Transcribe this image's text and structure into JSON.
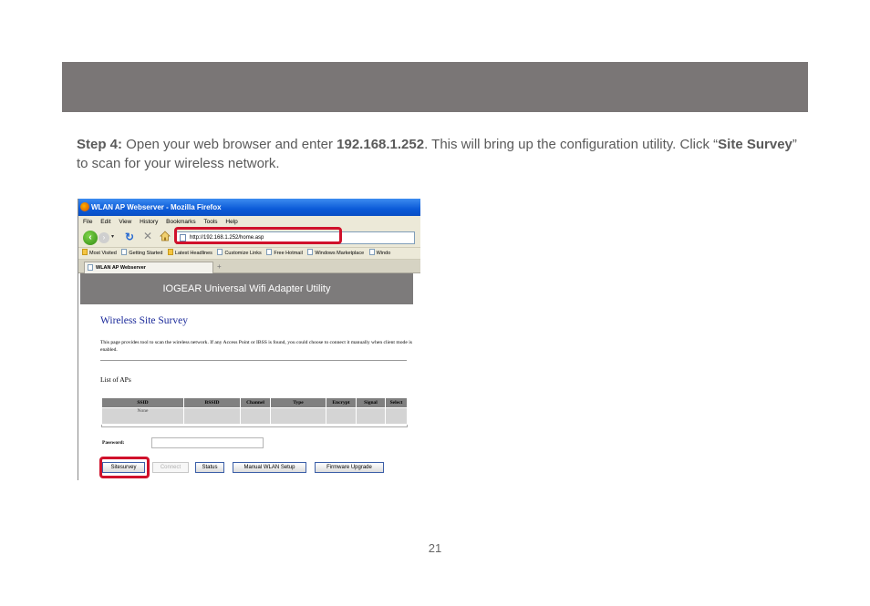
{
  "doc": {
    "step_label": "Step 4:",
    "text_part1": " Open your web browser and enter ",
    "ip": "192.168.1.252",
    "text_part2": ". This will bring up the configuration utility. Click “",
    "site_survey": "Site Survey",
    "text_part3": "” to scan for your wireless network.",
    "page_number": "21"
  },
  "browser": {
    "window_title": "WLAN AP Webserver - Mozilla Firefox",
    "menu": [
      "File",
      "Edit",
      "View",
      "History",
      "Bookmarks",
      "Tools",
      "Help"
    ],
    "url": "http://192.168.1.252/home.asp",
    "bookmarks": [
      {
        "label": "Most Visited",
        "icon": "folder-icon"
      },
      {
        "label": "Getting Started",
        "icon": "page-icon"
      },
      {
        "label": "Latest Headlines",
        "icon": "folder-icon"
      },
      {
        "label": "Customize Links",
        "icon": "page-icon"
      },
      {
        "label": "Free Hotmail",
        "icon": "page-icon"
      },
      {
        "label": "Windows Marketplace",
        "icon": "page-icon"
      },
      {
        "label": "Windo",
        "icon": "page-icon"
      }
    ],
    "tab_title": "WLAN AP Webserver",
    "new_tab": "+"
  },
  "page": {
    "banner": "IOGEAR Universal Wifi Adapter Utility",
    "title": "Wireless Site Survey",
    "description": "This page provides tool to scan the wireless network. If any Access Point or IBSS is found, you could choose to connect it manually when client mode is enabled.",
    "list_title": "List of APs",
    "table_headers": [
      "SSID",
      "BSSID",
      "Channel",
      "Type",
      "Encrypt",
      "Signal",
      "Select"
    ],
    "table_rows": [
      [
        "None",
        "",
        "",
        "",
        "",
        "",
        ""
      ]
    ],
    "password_label": "Password:",
    "password_value": "",
    "buttons": {
      "sitesurvey": "Sitesurvey",
      "connect": "Connect",
      "status": "Status",
      "manual": "Manual WLAN Setup",
      "firmware": "Firmware Upgrade"
    }
  },
  "colors": {
    "highlight": "#d0112b",
    "banner": "#7d7b7b",
    "title_blue": "#1b2a9a",
    "top_band": "#7a7676"
  }
}
